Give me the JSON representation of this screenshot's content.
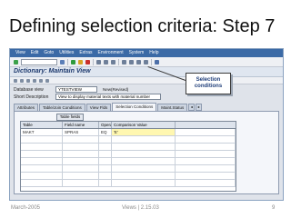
{
  "slide": {
    "title": "Defining selection criteria: Step 7"
  },
  "sap": {
    "menu": [
      "View",
      "Edit",
      "Goto",
      "Utilities",
      "Extras",
      "Environment",
      "System",
      "Help"
    ],
    "screen_title": "Dictionary: Maintain View",
    "fields": {
      "database_view_label": "Database view",
      "database_view_value": "YTESTVIEW",
      "database_view_status": "New(Revised)",
      "short_description_label": "Short Description",
      "short_description_value": "View to display material texts with material number"
    },
    "tabs": [
      "Attributes",
      "Table/Join Conditions",
      "View Flds",
      "Selection Conditions",
      "Maint.Status"
    ],
    "active_tab": "Selection Conditions",
    "table_fields_button": "Table fields",
    "grid": {
      "headers": [
        "Table",
        "Field name",
        "Operator",
        "Comparison Value",
        ""
      ],
      "rows": [
        [
          "MAKT",
          "SPRAS",
          "EQ",
          "'E'",
          ""
        ]
      ]
    },
    "callout": "Selection\nconditions"
  },
  "footer": {
    "date": "March-2005",
    "center": "Views | 2.15.03",
    "page": "9"
  },
  "colors": {
    "menubar": "#3b6aa6",
    "title_text": "#1e3a6e",
    "callout_text": "#1f3e7a"
  }
}
